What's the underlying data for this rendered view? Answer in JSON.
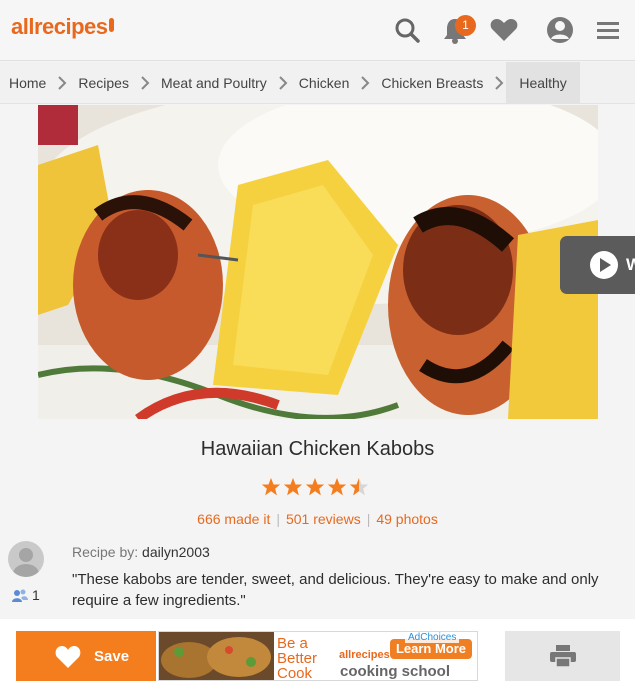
{
  "header": {
    "logo_text": "allrecipes",
    "notification_count": "1",
    "icons": [
      "search-icon",
      "bell-icon",
      "heart-icon",
      "profile-icon",
      "menu-icon"
    ]
  },
  "breadcrumb": [
    "Home",
    "Recipes",
    "Meat and Poultry",
    "Chicken",
    "Chicken Breasts",
    "Healthy"
  ],
  "hero": {
    "video_label": "W"
  },
  "recipe": {
    "title": "Hawaiian Chicken Kabobs",
    "rating": 4.5,
    "made_it": "666 made it",
    "reviews": "501 reviews",
    "photos": "49 photos",
    "recipe_by_label": "Recipe by:",
    "author": "dailyn2003",
    "followers": "1",
    "description": "\"These kabobs are tender, sweet, and delicious. They're easy to make and only require a few ingredients.\""
  },
  "bottom_bar": {
    "save_label": "Save",
    "ad": {
      "tagline": "Be a\nBetter\nCook",
      "brand": "allrecipes",
      "school": "cooking school",
      "cta": "Learn More",
      "choices": "AdChoices"
    }
  },
  "colors": {
    "brand_orange": "#e8691e",
    "save_orange": "#f47d1e"
  }
}
